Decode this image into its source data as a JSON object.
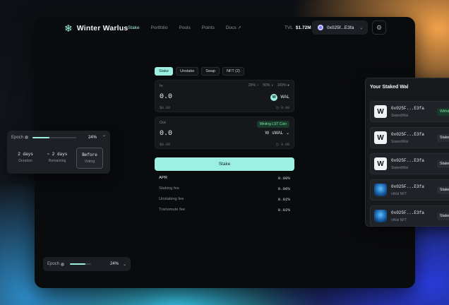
{
  "app": {
    "brand": "Winter Warlus"
  },
  "nav": {
    "links": [
      "Stake",
      "Portfolio",
      "Pools",
      "Points",
      "Docs"
    ],
    "tvl_label": "TVL",
    "tvl_value": "$1.72M",
    "wallet": "0x025f...E3fa"
  },
  "tabs": [
    "Stake",
    "Unstake",
    "Swap",
    "NFT (2)"
  ],
  "input": {
    "label": "In",
    "amount": "0.0",
    "usd": "$0.00",
    "balance": "0.00",
    "percents": [
      "25%",
      "50%",
      "100%"
    ],
    "token": "WAL"
  },
  "output": {
    "label": "Out",
    "amount": "0.0",
    "usd": "$0.00",
    "balance": "0.00",
    "minting_badge": "Minting LST Coin",
    "token": "sWAL"
  },
  "stake_button": "Stake",
  "stats": [
    {
      "key": "APR",
      "value": "0.00%"
    },
    {
      "key": "Staking fee",
      "value": "0.00%"
    },
    {
      "key": "Unstaking fee",
      "value": "0.02%"
    },
    {
      "key": "Transmute fee",
      "value": "0.02%"
    }
  ],
  "epoch_card": {
    "label": "Epoch",
    "percent": "24%",
    "progress": 0.24,
    "columns": [
      {
        "top": "2 days",
        "bottom": "Duration"
      },
      {
        "top": "~ 2 days",
        "bottom": "Remaining"
      },
      {
        "top": "Before",
        "bottom": "Voting"
      }
    ]
  },
  "epoch_mini": {
    "label": "Epoch",
    "percent": "24%",
    "progress": 0.24
  },
  "staked_panel": {
    "title": "Your Staked Wal",
    "rows": [
      {
        "icon": "W",
        "address": "0x025F...E3fa",
        "kind": "StakedWal",
        "status": "Withdraw"
      },
      {
        "icon": "W",
        "address": "0x025F...E3fa",
        "kind": "StakedWal",
        "status": "Staked"
      },
      {
        "icon": "W",
        "address": "0x025F...E3fa",
        "kind": "StakedWal",
        "status": "Staked"
      },
      {
        "icon": "nft",
        "address": "0x025F...E3fa",
        "kind": "nWal NFT",
        "status": "Staked"
      },
      {
        "icon": "nft",
        "address": "0x025F...E3fa",
        "kind": "nWal NFT",
        "status": "Staked"
      }
    ]
  },
  "colors": {
    "accent": "#9cf0e2",
    "success": "#7fe0a5",
    "background": "#0a0b0d"
  }
}
